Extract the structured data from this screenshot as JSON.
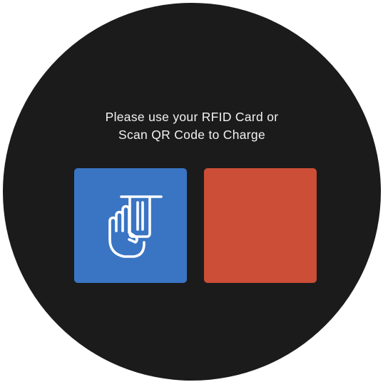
{
  "prompt": {
    "line1": "Please use your RFID Card or",
    "line2": "Scan QR Code to Charge"
  },
  "tiles": [
    {
      "id": "rfid",
      "icon": "rfid-card-tap-icon",
      "color": "#3a75c4"
    },
    {
      "id": "qr",
      "icon": "none",
      "color": "#cc4e36"
    }
  ],
  "colors": {
    "screen_bg": "#1b1b1b",
    "text": "#f2f2f2",
    "rfid_tile": "#3a75c4",
    "qr_tile": "#cc4e36"
  }
}
